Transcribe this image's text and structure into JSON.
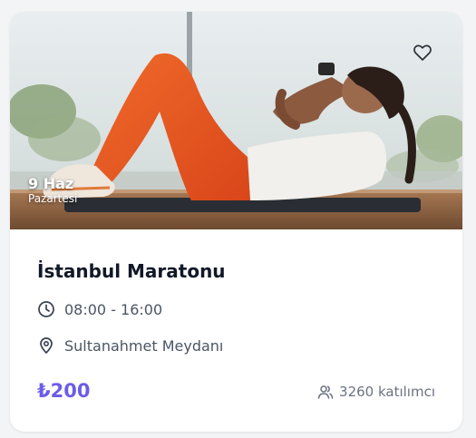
{
  "event": {
    "date_day": "9 Haz",
    "date_weekday": "Pazartesi",
    "title": "İstanbul Maratonu",
    "time": "08:00 - 16:00",
    "location": "Sultanahmet Meydanı",
    "price": "₺200",
    "participants": "3260 katılımcı"
  },
  "icons": {
    "favorite": "heart-icon",
    "time": "clock-icon",
    "location": "map-pin-icon",
    "participants": "users-icon"
  },
  "colors": {
    "price": "#6d5ce8",
    "title": "#111827",
    "meta_text": "#4b5563"
  }
}
